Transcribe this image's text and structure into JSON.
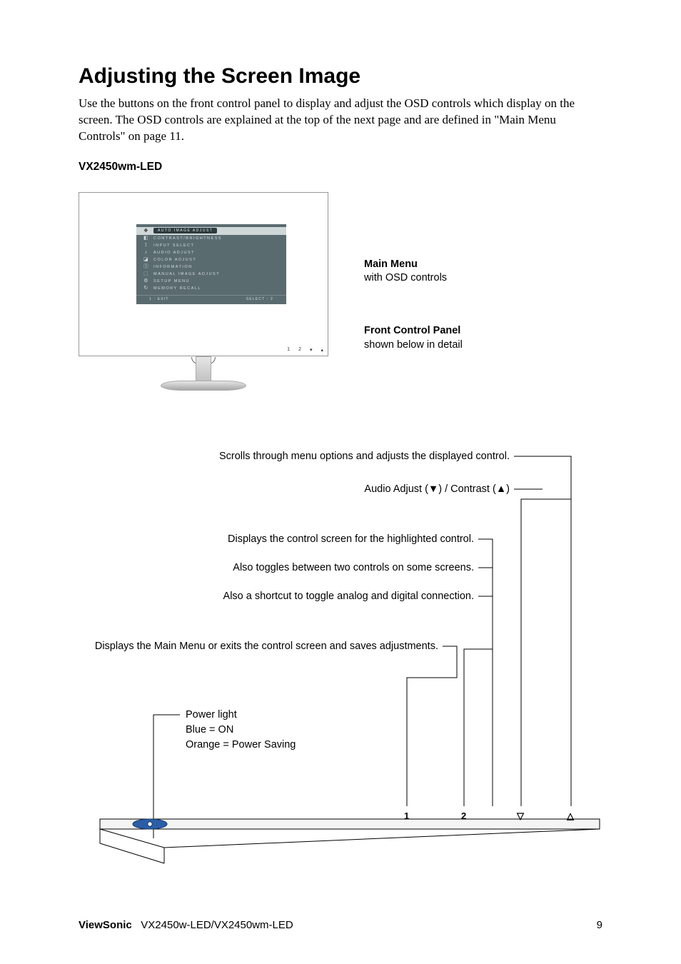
{
  "heading": "Adjusting the Screen Image",
  "intro": "Use the buttons on the front control panel to display and adjust the OSD controls which display on the screen. The OSD controls are explained at the top of the next page and are defined in \"Main Menu Controls\" on page 11.",
  "model": "VX2450wm-LED",
  "osd": {
    "items": [
      {
        "icon": "✥",
        "label": "AUTO IMAGE ADJUST",
        "hl": true
      },
      {
        "icon": "◧",
        "label": "CONTRAST/BRIGHTNESS"
      },
      {
        "icon": "⟟",
        "label": "INPUT SELECT"
      },
      {
        "icon": "♪",
        "label": "AUDIO ADJUST"
      },
      {
        "icon": "◪",
        "label": "COLOR ADJUST"
      },
      {
        "icon": "ⓘ",
        "label": "INFORMATION"
      },
      {
        "icon": "⬚",
        "label": "MANUAL IMAGE ADJUST"
      },
      {
        "icon": "⚙",
        "label": "SETUP MENU"
      },
      {
        "icon": "↻",
        "label": "MEMORY RECALL"
      }
    ],
    "footer_left": "1 : EXIT",
    "footer_right": "SELECT : 2"
  },
  "side": {
    "main_title": "Main Menu",
    "main_sub": "with OSD controls",
    "front_title": "Front Control Panel",
    "front_sub": "shown below in detail"
  },
  "diagram": {
    "scroll": "Scrolls through menu options and adjusts the displayed control.",
    "audio": "Audio Adjust (▼) / Contrast  (▲)",
    "highlight": "Displays the control screen for the highlighted control.",
    "toggle": "Also toggles between two controls on some screens.",
    "shortcut": "Also a shortcut to toggle analog and digital connection.",
    "mainexit": "Displays the Main Menu or exits the control screen and saves adjustments.",
    "power_l1": "Power light",
    "power_l2": "Blue = ON",
    "power_l3": "Orange = Power Saving"
  },
  "buttons": {
    "b1": "1",
    "b2": "2",
    "down": "▽",
    "up": "△"
  },
  "footer": {
    "brand": "ViewSonic",
    "models": "VX2450w-LED/VX2450wm-LED",
    "page": "9"
  }
}
